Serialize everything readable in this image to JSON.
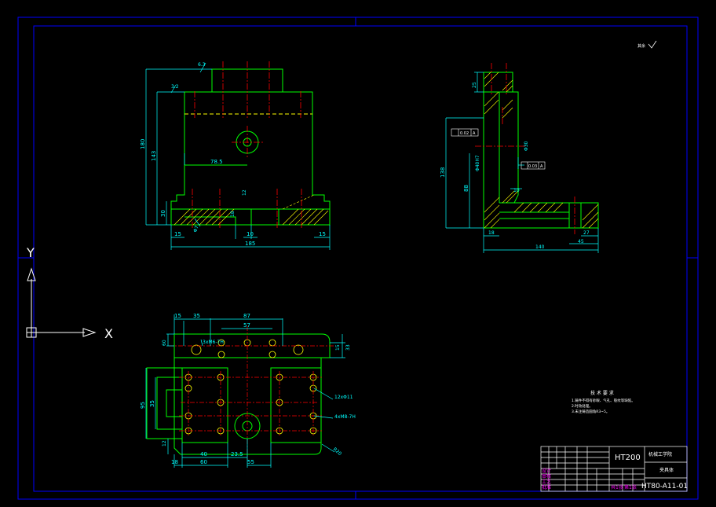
{
  "ucs": {
    "x_label": "X",
    "y_label": "Y"
  },
  "front_view": {
    "dims": {
      "total_height": "180",
      "height_143": "143",
      "base_height": "30",
      "hole_offset": "78.5",
      "slot_12": "12",
      "d15_left": "15",
      "d10": "10",
      "d15_right": "15",
      "width": "185",
      "hole_dia": "Φ7",
      "small_18": "18",
      "rough_a": "6.3",
      "rough_b": "3.2"
    }
  },
  "side_view": {
    "dims": {
      "top_25": "25",
      "h138": "138",
      "h88": "88",
      "d18": "18",
      "d10": "10",
      "d45": "45",
      "d27": "27",
      "width_140": "140",
      "tol_label": "0.02",
      "tol_ref": "A",
      "perp_label": "0.03",
      "bore_1": "Φ40H7",
      "bore_2": "Φ30"
    }
  },
  "top_view": {
    "dims": {
      "d15": "15",
      "d35": "35",
      "d87": "87",
      "d57": "57",
      "d60_left": "60",
      "d15_right": "15",
      "d33": "33",
      "d95": "95",
      "d35v": "35",
      "d12": "12",
      "d40": "40",
      "d60_bottom": "60",
      "d23_5": "23.5",
      "d55": "55",
      "d18": "18",
      "r20": "R20",
      "holes_note_1": "3xM6-7H",
      "holes_note_2": "12xΦ11",
      "holes_note_3": "4xM8-7H"
    }
  },
  "roughness_mark": "其余",
  "tech_requirements": {
    "title": "技 术 要 求",
    "items": [
      "1.铸件不得有砂眼、气孔、裂纹等缺陷。",
      "2.时效处理。",
      "3.未注铸造圆角R3~5。"
    ]
  },
  "title_block": {
    "material": "HT200",
    "school": "机械工学院",
    "part_name": "夹具体",
    "drawing_no": "HT80-A11-01",
    "sub_labels": [
      "设计",
      "审核",
      "工艺",
      "批准"
    ],
    "scale_labels": [
      "共1张",
      "第1张"
    ]
  },
  "colors": {
    "border": "#0000ff",
    "outline": "#00ff00",
    "dimension": "#00ffff",
    "center": "#ff0000",
    "hidden": "#ffff00",
    "text_magenta": "#ff00ff"
  }
}
